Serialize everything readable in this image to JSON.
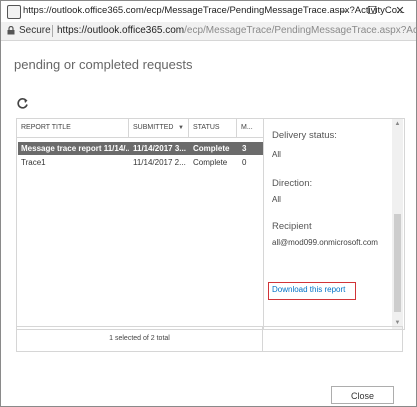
{
  "window": {
    "title": "https://outlook.office365.com/ecp/MessageTrace/PendingMessageTrace.aspx?ActivityCo...",
    "controls": {
      "minimize": "–",
      "maximize": "☐",
      "close": "✕"
    }
  },
  "address_bar": {
    "secure_label": "Secure",
    "url_host": "https://outlook.office365.com",
    "url_path": "/ecp/MessageTrace/PendingMessageTrace.aspx?ActivityC..."
  },
  "page": {
    "heading": "pending or completed requests"
  },
  "table": {
    "headers": [
      "REPORT TITLE",
      "SUBMITTED",
      "STATUS",
      "M..."
    ],
    "sort_indicator": "▼",
    "rows": [
      {
        "title": "Message trace report 11/14/...",
        "submitted": "11/14/2017 3...",
        "status": "Complete",
        "m": "3",
        "selected": true
      },
      {
        "title": "Trace1",
        "submitted": "11/14/2017 2...",
        "status": "Complete",
        "m": "0",
        "selected": false
      }
    ],
    "footer": "1 selected of 2 total"
  },
  "details": {
    "delivery_label": "Delivery status:",
    "delivery_value": "All",
    "direction_label": "Direction:",
    "direction_value": "All",
    "recipient_label": "Recipient",
    "recipient_value": "all@mod099.onmicrosoft.com",
    "download_link": "Download this report"
  },
  "buttons": {
    "close": "Close"
  },
  "colors": {
    "selected_row": "#6b6b6b",
    "link": "#0072c6",
    "highlight_border": "#d13438"
  }
}
